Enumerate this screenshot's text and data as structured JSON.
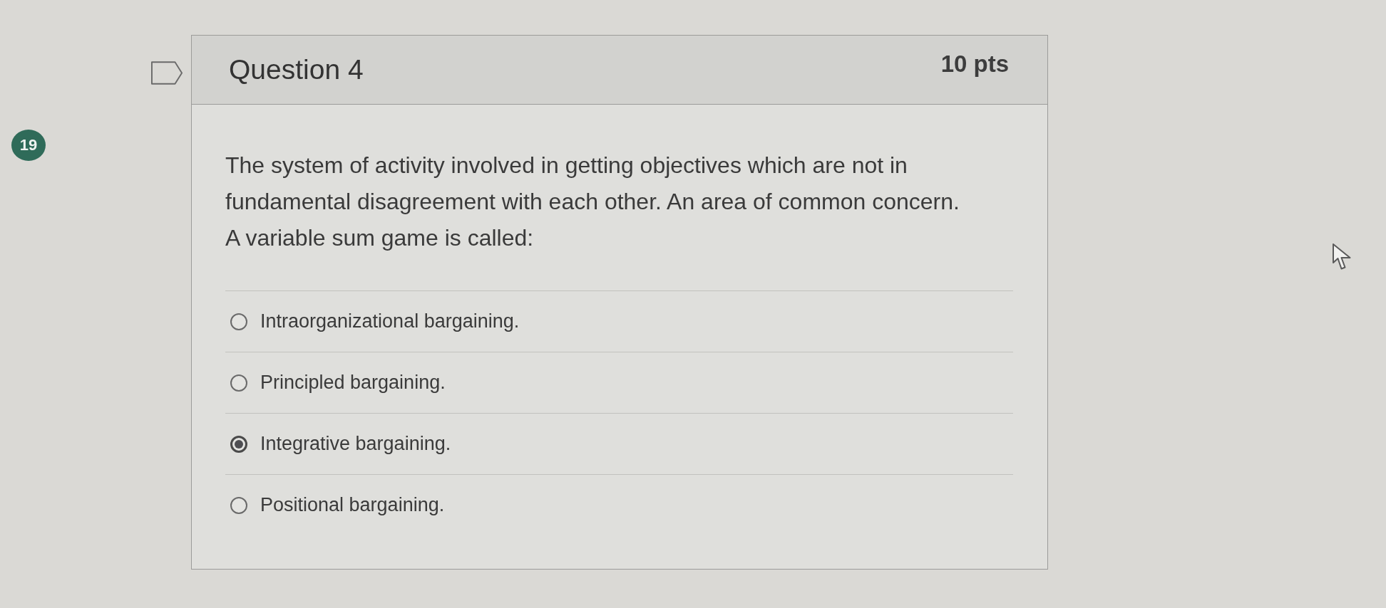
{
  "badge": {
    "text": "19"
  },
  "question": {
    "title": "Question 4",
    "points": "10 pts",
    "flagged": false,
    "text": "The system of activity involved in getting objectives which are not in fundamental disagreement with each other. An area of common concern. A variable sum game is called:"
  },
  "answers": [
    {
      "label": "Intraorganizational bargaining.",
      "selected": false
    },
    {
      "label": "Principled bargaining.",
      "selected": false
    },
    {
      "label": "Integrative bargaining.",
      "selected": true
    },
    {
      "label": "Positional bargaining.",
      "selected": false
    }
  ]
}
